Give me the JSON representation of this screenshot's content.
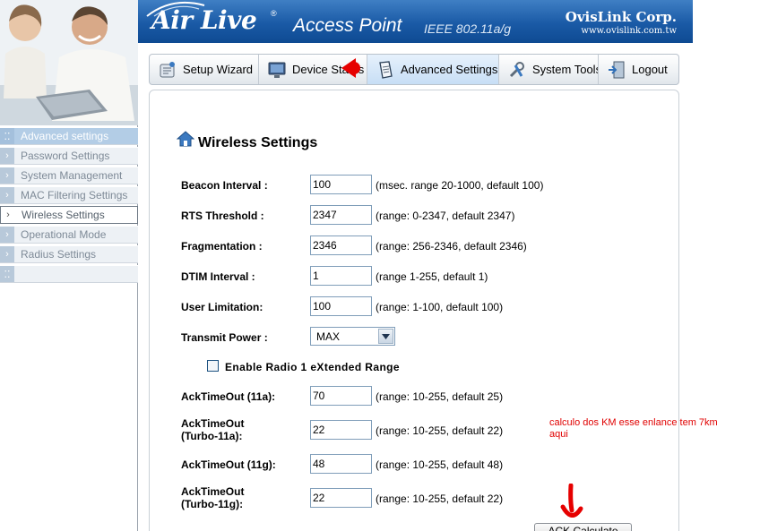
{
  "header": {
    "brand": "Air Live",
    "trademark": "®",
    "product": "Access Point",
    "standard": "IEEE 802.11a/g",
    "company": "OvisLink Corp.",
    "company_url": "www.ovislink.com.tw"
  },
  "toolbar": {
    "items": [
      {
        "label": "Setup Wizard",
        "icon": "wizard-icon"
      },
      {
        "label": "Device Status",
        "icon": "monitor-icon"
      },
      {
        "label": "Advanced Settings",
        "icon": "document-icon"
      },
      {
        "label": "System Tools",
        "icon": "tools-icon"
      },
      {
        "label": "Logout",
        "icon": "logout-door-icon"
      }
    ],
    "active": "Advanced Settings"
  },
  "sidebar": {
    "header": "Advanced settings",
    "items": [
      {
        "label": "Password Settings"
      },
      {
        "label": "System Management"
      },
      {
        "label": "MAC Filtering Settings"
      },
      {
        "label": "Wireless Settings"
      },
      {
        "label": "Operational Mode"
      },
      {
        "label": "Radius Settings"
      },
      {
        "label": ""
      }
    ],
    "active": "Wireless Settings"
  },
  "page": {
    "title": "Wireless Settings",
    "fields": [
      {
        "label": "Beacon Interval :",
        "value": "100",
        "hint": "(msec. range 20-1000, default 100)"
      },
      {
        "label": "RTS Threshold :",
        "value": "2347",
        "hint": "(range: 0-2347, default 2347)"
      },
      {
        "label": "Fragmentation :",
        "value": "2346",
        "hint": "(range: 256-2346, default 2346)"
      },
      {
        "label": "DTIM Interval :",
        "value": "1",
        "hint": "(range 1-255, default 1)"
      },
      {
        "label": "User Limitation:",
        "value": "100",
        "hint": "(range: 1-100, default 100)"
      }
    ],
    "transmit_power": {
      "label": "Transmit Power :",
      "value": "MAX"
    },
    "extended_range": {
      "label": "Enable Radio 1 eXtended Range",
      "checked": false
    },
    "ack_fields": [
      {
        "label": "AckTimeOut (11a):",
        "value": "70",
        "hint": "(range: 10-255, default 25)"
      },
      {
        "label_line1": "AckTimeOut",
        "label_line2": "(Turbo-11a):",
        "value": "22",
        "hint": "(range: 10-255, default 22)"
      },
      {
        "label": "AckTimeOut (11g):",
        "value": "48",
        "hint": "(range: 10-255, default 48)"
      },
      {
        "label_line1": "AckTimeOut",
        "label_line2": "(Turbo-11g):",
        "value": "22",
        "hint": "(range: 10-255, default 22)"
      }
    ],
    "calc_button": "ACK Calculate"
  },
  "annotation": {
    "text": "calculo dos KM esse enlance tem 7km\naqui",
    "color": "#e00000"
  },
  "colors": {
    "banner": "#1a5aa6",
    "sidebar_header": "#b3cde6",
    "annotation_red": "#e00000"
  }
}
